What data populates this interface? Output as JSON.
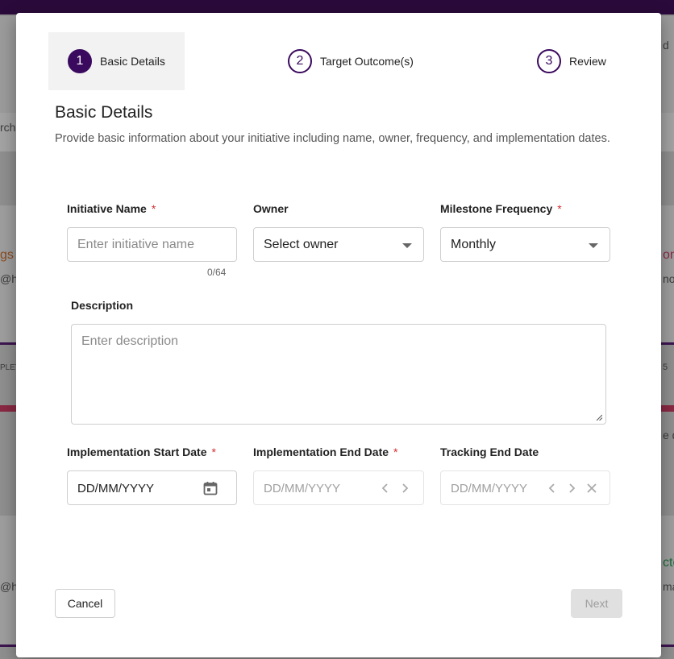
{
  "background": {
    "texts": [
      "rch",
      "gs",
      "@h",
      "PLETI",
      "@h",
      "d",
      "on",
      "nou",
      "5",
      "e d",
      "cto",
      "mak"
    ]
  },
  "stepper": {
    "steps": [
      {
        "number": "1",
        "label": "Basic Details",
        "active": true
      },
      {
        "number": "2",
        "label": "Target Outcome(s)",
        "active": false
      },
      {
        "number": "3",
        "label": "Review",
        "active": false
      }
    ]
  },
  "section": {
    "title": "Basic Details",
    "description": "Provide basic information about your initiative including name, owner, frequency, and implementation dates."
  },
  "form": {
    "initiative_name": {
      "label": "Initiative Name",
      "required": "*",
      "placeholder": "Enter initiative name",
      "value": "",
      "counter": "0/64"
    },
    "owner": {
      "label": "Owner",
      "placeholder": "Select owner"
    },
    "milestone_frequency": {
      "label": "Milestone Frequency",
      "required": "*",
      "value": "Monthly"
    },
    "description": {
      "label": "Description",
      "placeholder": "Enter description"
    },
    "implementation_start": {
      "label": "Implementation Start Date",
      "required": "*",
      "placeholder": "DD/MM/YYYY"
    },
    "implementation_end": {
      "label": "Implementation End Date",
      "required": "*",
      "placeholder": "DD/MM/YYYY"
    },
    "tracking_end": {
      "label": "Tracking End Date",
      "placeholder": "DD/MM/YYYY"
    }
  },
  "actions": {
    "cancel_label": "Cancel",
    "next_label": "Next"
  },
  "colors": {
    "primary": "#3a0a5e",
    "required": "#d32f2f",
    "disabled_bg": "#e0e0e0"
  }
}
